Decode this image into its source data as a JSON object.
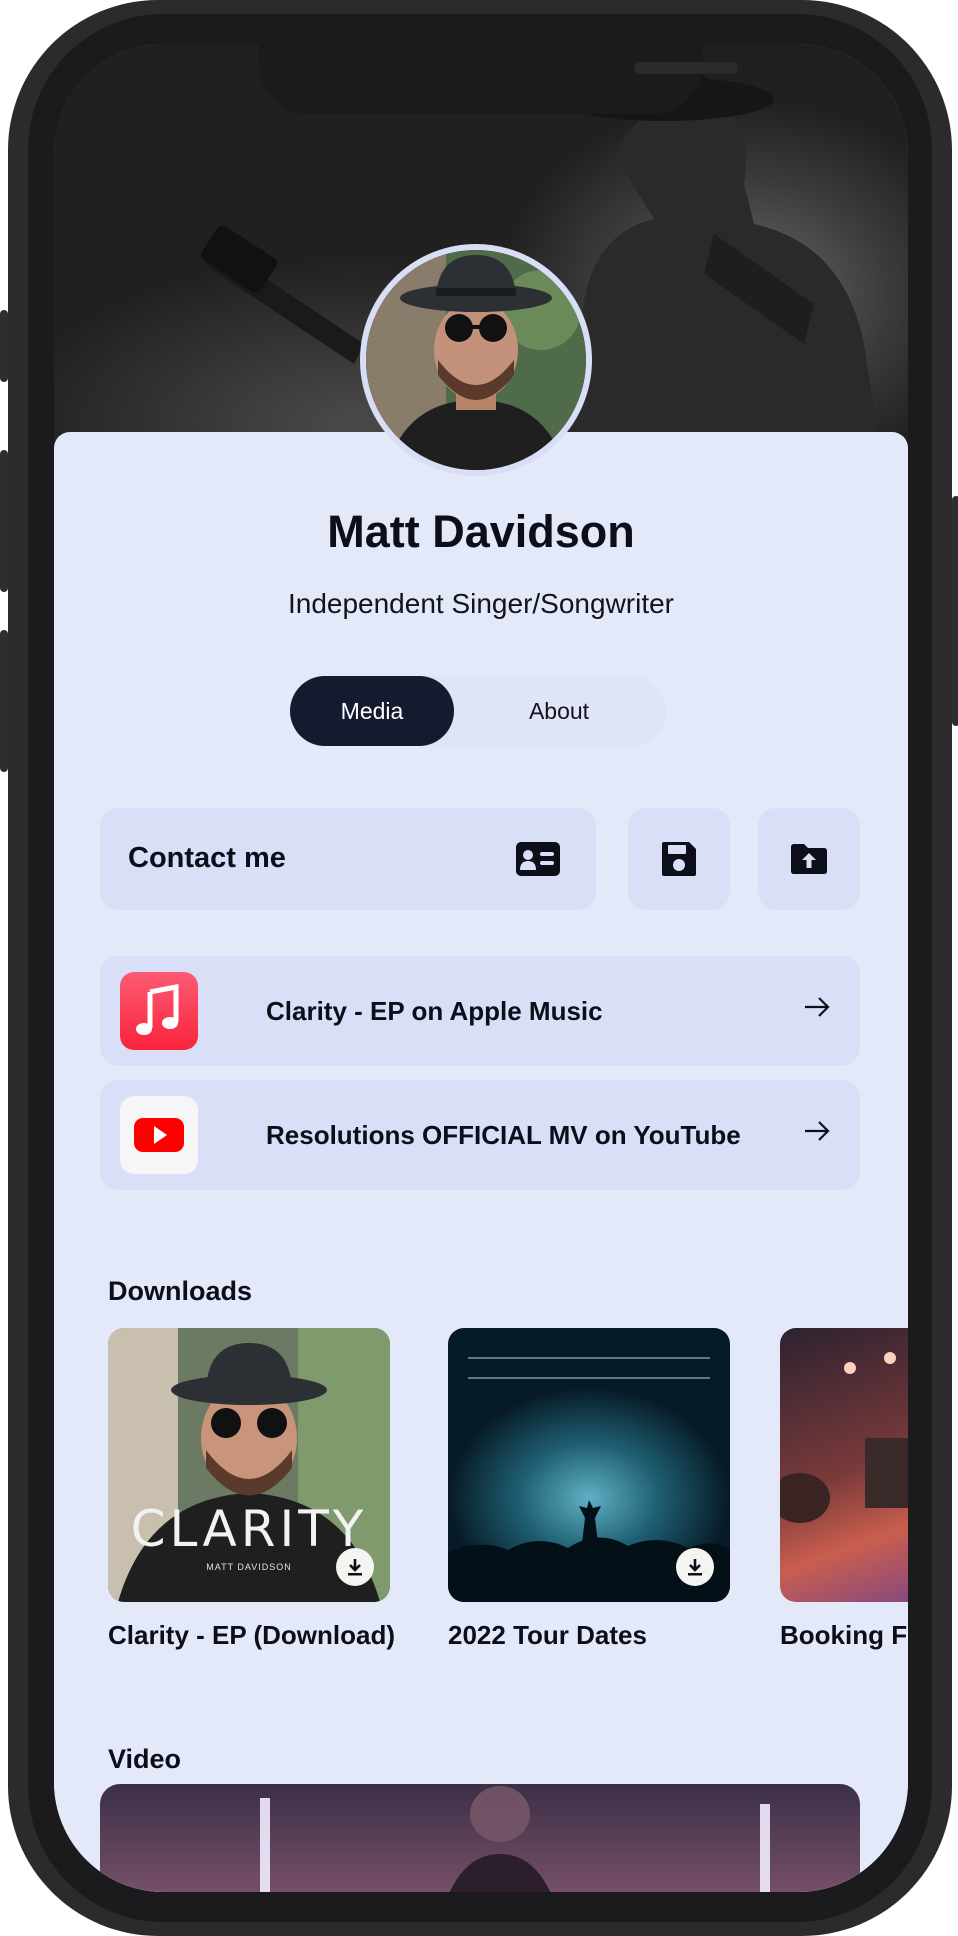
{
  "profile": {
    "name": "Matt Davidson",
    "subtitle": "Independent Singer/Songwriter"
  },
  "tabs": [
    {
      "label": "Media",
      "active": true
    },
    {
      "label": "About",
      "active": false
    }
  ],
  "actions": {
    "contact_label": "Contact me",
    "contact_icon": "contact-card-icon",
    "save_icon": "floppy-disk-icon",
    "share_icon": "folder-upload-icon"
  },
  "links": [
    {
      "label": "Clarity - EP on Apple Music",
      "icon": "apple-music-icon",
      "color": "#fa2d48"
    },
    {
      "label": "Resolutions OFFICIAL MV on YouTube",
      "icon": "youtube-icon",
      "color": "#ff0000"
    }
  ],
  "downloads": {
    "title": "Downloads",
    "items": [
      {
        "label": "Clarity - EP (Download)",
        "cover_text": "CLARITY",
        "cover_subtext": "MATT DAVIDSON"
      },
      {
        "label": "2022 Tour Dates"
      },
      {
        "label": "Booking Fo"
      }
    ]
  },
  "video": {
    "title": "Video"
  },
  "colors": {
    "background": "#e4e9fa",
    "card": "#d8dff7",
    "active_tab": "#141b2e"
  }
}
